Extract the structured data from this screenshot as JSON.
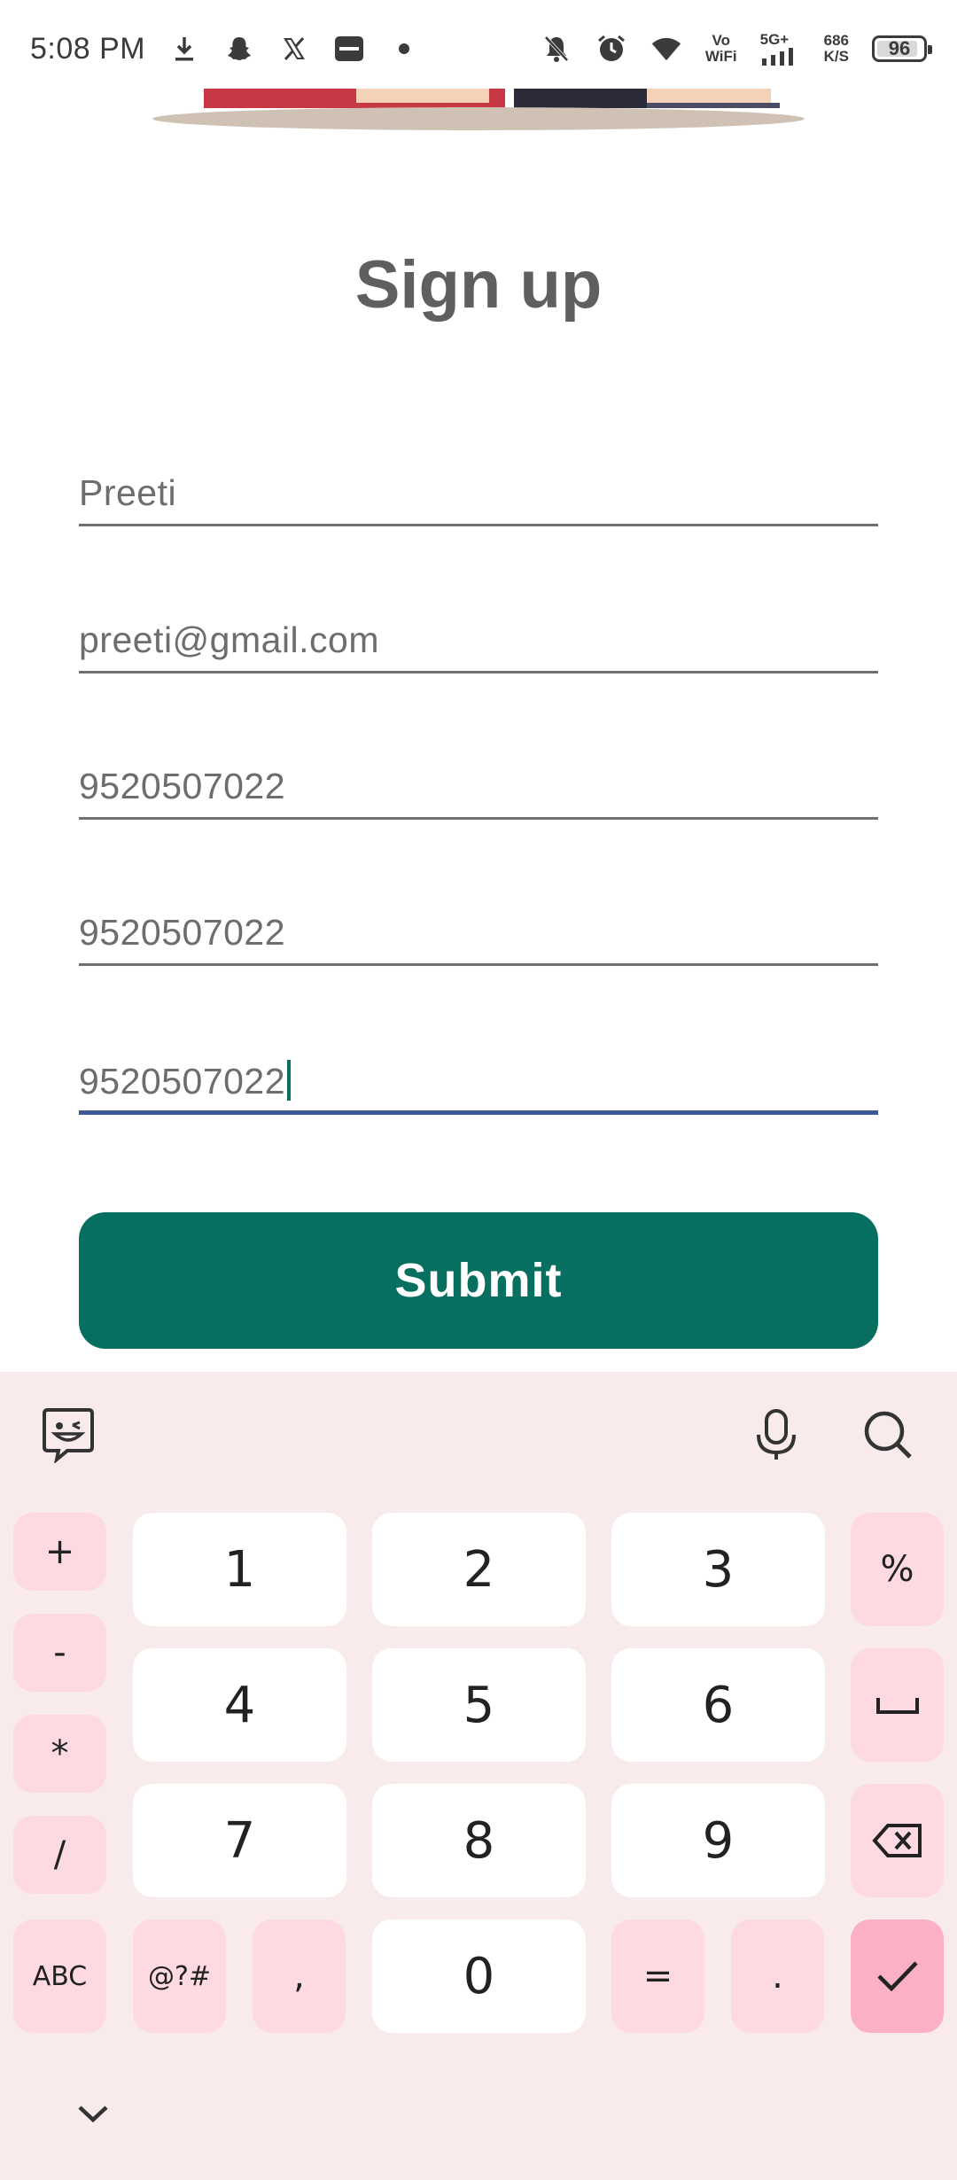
{
  "status_bar": {
    "time": "5:08 PM",
    "net_type_top": "Vo",
    "net_type_bottom": "WiFi",
    "signal_label": "5G+",
    "speed_value": "686",
    "speed_unit": "K/S",
    "battery": "96"
  },
  "page": {
    "title": "Sign up",
    "fields": [
      {
        "value": "Preeti"
      },
      {
        "value": "preeti@gmail.com"
      },
      {
        "value": "9520507022"
      },
      {
        "value": "9520507022"
      },
      {
        "value": "9520507022"
      }
    ],
    "submit_label": "Submit"
  },
  "keyboard": {
    "left_column": [
      "+",
      "-",
      "*",
      "/"
    ],
    "digits": [
      "1",
      "2",
      "3",
      "4",
      "5",
      "6",
      "7",
      "8",
      "9",
      "0"
    ],
    "right_column": [
      "%",
      "␣"
    ],
    "bottom_row": [
      "ABC",
      "@?#",
      ",",
      "=",
      "."
    ]
  },
  "colors": {
    "primary": "#066f60",
    "active_underline": "#3c5a91",
    "keyboard_bg": "#f9ebeb",
    "function_key": "#fdd9e2",
    "enter_key": "#fbb0c5"
  }
}
